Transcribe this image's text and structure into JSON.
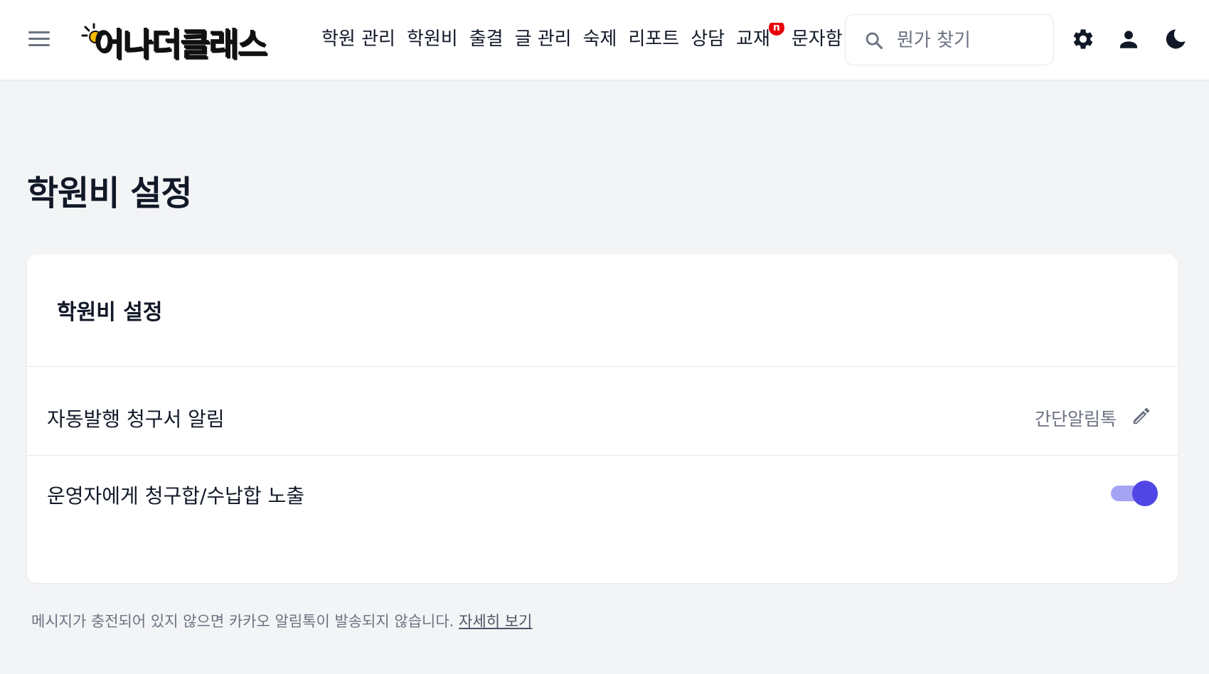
{
  "header": {
    "logo_text": "어나더클래스",
    "nav": [
      {
        "label": "학원 관리"
      },
      {
        "label": "학원비"
      },
      {
        "label": "출결"
      },
      {
        "label": "글 관리"
      },
      {
        "label": "숙제"
      },
      {
        "label": "리포트"
      },
      {
        "label": "상담"
      },
      {
        "label": "교재",
        "badge": "n"
      },
      {
        "label": "문자함"
      }
    ],
    "search": {
      "placeholder": "뭔가 찾기"
    },
    "icons": [
      "menu-icon",
      "search-icon",
      "gear-icon",
      "user-icon",
      "moon-icon"
    ],
    "badge_color": "#e8000b"
  },
  "page": {
    "title": "학원비 설정"
  },
  "card": {
    "title": "학원비 설정",
    "rows": [
      {
        "label": "자동발행 청구서 알림",
        "value": "간단알림톡",
        "icon": "pencil-icon"
      },
      {
        "label": "운영자에게 청구합/수납합 노출",
        "toggle_on": true
      }
    ],
    "accent_color": "#4f46e5"
  },
  "footer": {
    "note": "메시지가 충전되어 있지 않으면 카카오 알림톡이 발송되지 않습니다.",
    "link": "자세히 보기"
  }
}
